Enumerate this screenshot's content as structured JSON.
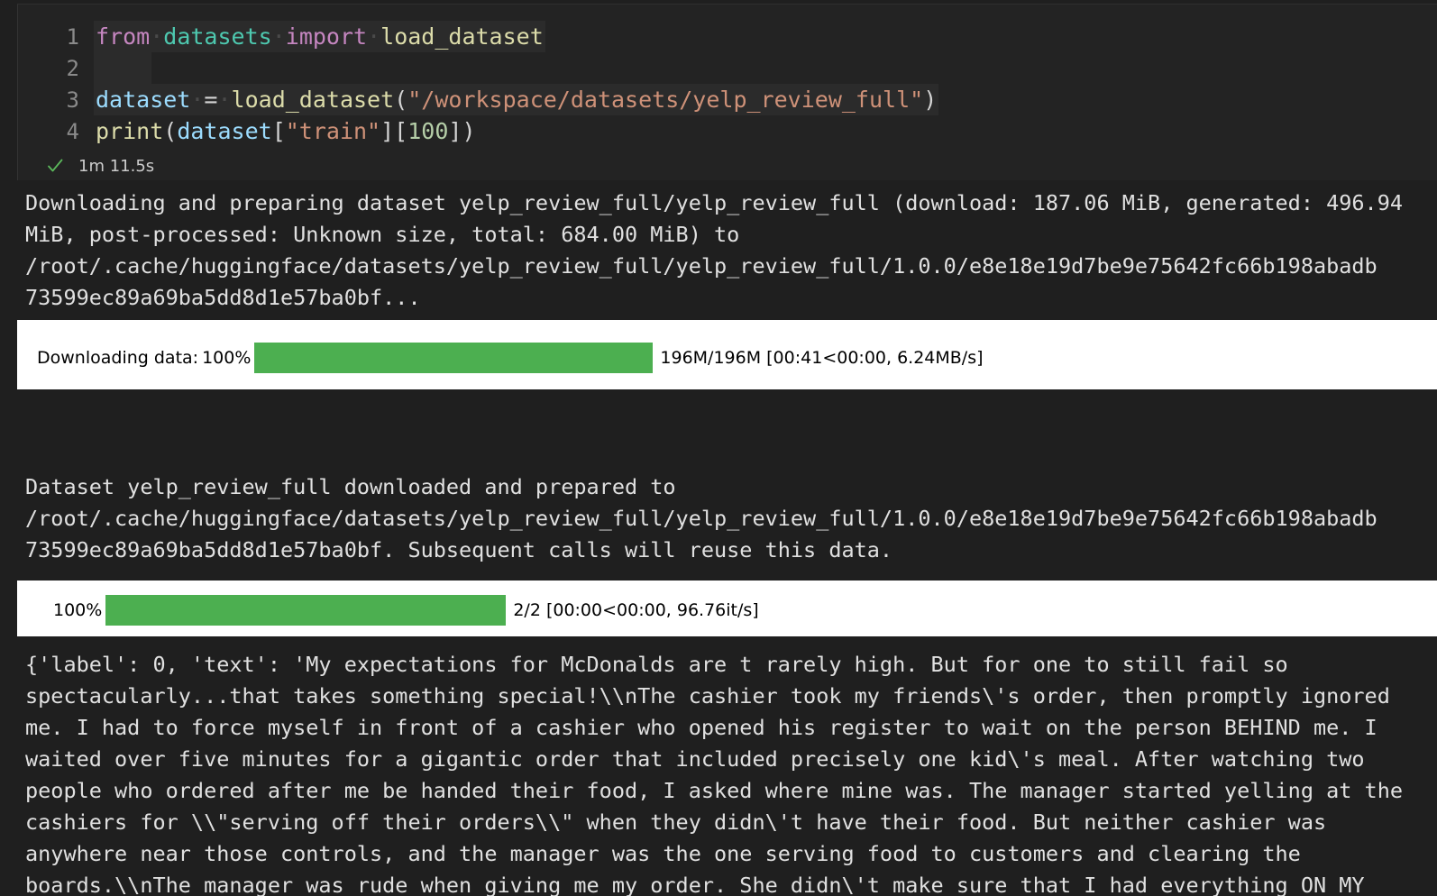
{
  "notebook": {
    "execution_bracket": "]",
    "status": {
      "icon": "check-success-icon",
      "duration": "1m 11.5s"
    },
    "accent_colors": {
      "success_green": "#4caf50",
      "progress_green": "#4caf50",
      "cell_background": "#232323",
      "page_background": "#1f1f1f",
      "output_text": "#e0e0e0"
    },
    "code_cell": {
      "lines": [
        {
          "number": "1",
          "tokens": [
            {
              "t": "from",
              "c": "tok-kw"
            },
            {
              "t": "·",
              "c": "ws-dot"
            },
            {
              "t": "datasets",
              "c": "tok-mod"
            },
            {
              "t": "·",
              "c": "ws-dot"
            },
            {
              "t": "import",
              "c": "tok-kw"
            },
            {
              "t": "·",
              "c": "ws-dot"
            },
            {
              "t": "load_dataset",
              "c": "tok-fn"
            }
          ]
        },
        {
          "number": "2",
          "tokens": [
            {
              "t": "    ",
              "c": "tok-punct"
            }
          ]
        },
        {
          "number": "3",
          "tokens": [
            {
              "t": "dataset",
              "c": "tok-var"
            },
            {
              "t": "·",
              "c": "ws-dot"
            },
            {
              "t": "=",
              "c": "tok-op"
            },
            {
              "t": "·",
              "c": "ws-dot"
            },
            {
              "t": "load_dataset",
              "c": "tok-fn"
            },
            {
              "t": "(",
              "c": "tok-punct"
            },
            {
              "t": "\"/workspace/datasets/yelp_review_full\"",
              "c": "tok-str"
            },
            {
              "t": ")",
              "c": "tok-punct"
            }
          ]
        },
        {
          "number": "4",
          "tokens": [
            {
              "t": "print",
              "c": "tok-fn"
            },
            {
              "t": "(",
              "c": "tok-punct"
            },
            {
              "t": "dataset",
              "c": "tok-var"
            },
            {
              "t": "[",
              "c": "tok-punct"
            },
            {
              "t": "\"train\"",
              "c": "tok-str"
            },
            {
              "t": "]",
              "c": "tok-punct"
            },
            {
              "t": "[",
              "c": "tok-punct"
            },
            {
              "t": "100",
              "c": "tok-num"
            },
            {
              "t": "]",
              "c": "tok-punct"
            },
            {
              "t": ")",
              "c": "tok-punct"
            }
          ]
        }
      ]
    },
    "outputs": {
      "download_notice": "Downloading and preparing dataset yelp_review_full/yelp_review_full (download: 187.06 MiB, generated: 496.94\nMiB, post-processed: Unknown size, total: 684.00 MiB) to\n/root/.cache/huggingface/datasets/yelp_review_full/yelp_review_full/1.0.0/e8e18e19d7be9e75642fc66b198abadb\n73599ec89a69ba5dd8d1e57ba0bf...",
      "prepared_notice": "Dataset yelp_review_full downloaded and prepared to\n/root/.cache/huggingface/datasets/yelp_review_full/yelp_review_full/1.0.0/e8e18e19d7be9e75642fc66b198abadb\n73599ec89a69ba5dd8d1e57ba0bf. Subsequent calls will reuse this data.",
      "record_print": "{'label': 0, 'text': 'My expectations for McDonalds are t rarely high. But for one to still fail so\nspectacularly...that takes something special!\\\\nThe cashier took my friends\\'s order, then promptly ignored\nme. I had to force myself in front of a cashier who opened his register to wait on the person BEHIND me. I\nwaited over five minutes for a gigantic order that included precisely one kid\\'s meal. After watching two\npeople who ordered after me be handed their food, I asked where mine was. The manager started yelling at the\ncashiers for \\\\\"serving off their orders\\\\\" when they didn\\'t have their food. But neither cashier was\nanywhere near those controls, and the manager was the one serving food to customers and clearing the\nboards.\\\\nThe manager was rude when giving me my order. She didn\\'t make sure that I had everything ON MY"
    },
    "progress_bars": [
      {
        "id": "download",
        "label": "Downloading data:",
        "percent_text": "100%",
        "percent_value": 100,
        "stats": "196M/196M [00:41<00:00, 6.24MB/s]",
        "current": "196M",
        "total": "196M",
        "elapsed": "00:41",
        "remaining": "00:00",
        "rate": "6.24MB/s"
      },
      {
        "id": "generate",
        "label": "",
        "percent_text": "100%",
        "percent_value": 100,
        "stats": "2/2 [00:00<00:00, 96.76it/s]",
        "current": "2",
        "total": "2",
        "elapsed": "00:00",
        "remaining": "00:00",
        "rate": "96.76it/s"
      }
    ]
  }
}
